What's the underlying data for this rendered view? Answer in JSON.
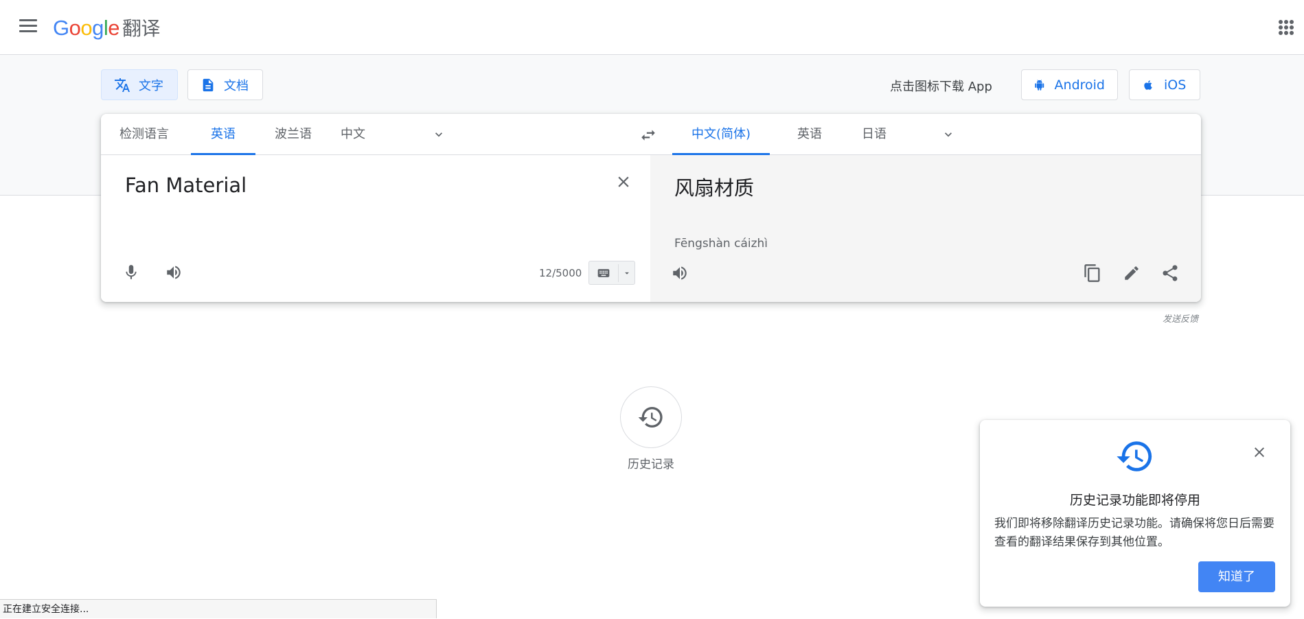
{
  "header": {
    "logo_text": "Google",
    "product_name": "翻译"
  },
  "modes": {
    "text_label": "文字",
    "document_label": "文档"
  },
  "app_download": {
    "prompt": "点击图标下载 App",
    "android_label": "Android",
    "ios_label": "iOS"
  },
  "source_languages": [
    {
      "label": "检测语言",
      "active": false
    },
    {
      "label": "英语",
      "active": true
    },
    {
      "label": "波兰语",
      "active": false
    },
    {
      "label": "中文",
      "active": false
    }
  ],
  "target_languages": [
    {
      "label": "中文(简体)",
      "active": true
    },
    {
      "label": "英语",
      "active": false
    },
    {
      "label": "日语",
      "active": false
    }
  ],
  "source": {
    "text": "Fan Material",
    "char_count": "12/5000"
  },
  "target": {
    "text": "风扇材质",
    "transliteration": "Fēngshàn cáizhì"
  },
  "feedback_label": "发送反馈",
  "history": {
    "label": "历史记录"
  },
  "notice": {
    "title": "历史记录功能即将停用",
    "body": "我们即将移除翻译历史记录功能。请确保将您日后需要查看的翻译结果保存到其他位置。",
    "button_label": "知道了"
  },
  "status_bar": {
    "text": "正在建立安全连接..."
  },
  "colors": {
    "accent": "#1a73e8",
    "button_blue": "#4285f4"
  }
}
